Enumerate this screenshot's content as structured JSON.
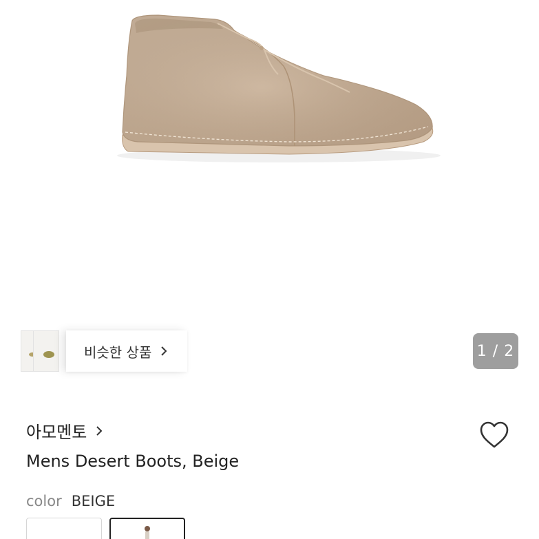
{
  "gallery": {
    "similar_label": "비슷한 상품",
    "current_page": "1",
    "total_pages": "2",
    "counter_text": "1 / 2"
  },
  "product": {
    "brand": "아모멘토",
    "title": "Mens Desert Boots, Beige",
    "color_label": "color",
    "color_value": "BEIGE"
  },
  "colors": {
    "boot": "#c9b299",
    "counter_bg": "#9e9e9e"
  },
  "icons": {
    "chevron": "chevron-right-icon",
    "heart": "heart-outline-icon"
  }
}
